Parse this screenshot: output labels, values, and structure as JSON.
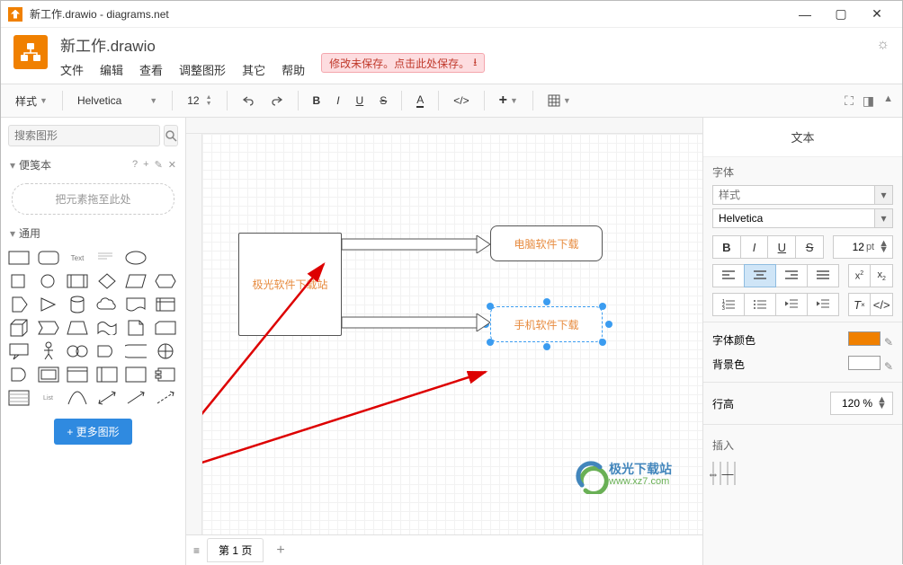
{
  "titlebar": {
    "title": "新工作.drawio - diagrams.net"
  },
  "header": {
    "filename": "新工作.drawio",
    "menus": [
      "文件",
      "编辑",
      "查看",
      "调整图形",
      "其它",
      "帮助"
    ],
    "save_warning": "修改未保存。点击此处保存。"
  },
  "toolbar": {
    "style_label": "样式",
    "font": "Helvetica",
    "font_size": "12"
  },
  "left": {
    "search_placeholder": "搜索图形",
    "scratchpad": "便笺本",
    "drop_hint": "把元素拖至此处",
    "general": "通用",
    "more_shapes": "+ 更多图形"
  },
  "canvas": {
    "box_main": "极光软件下载站",
    "box_top": "电脑软件下载",
    "box_bottom": "手机软件下载"
  },
  "pages": {
    "page1": "第 1 页"
  },
  "right": {
    "title": "文本",
    "font_lab": "字体",
    "style_ph": "样式",
    "font_name": "Helvetica",
    "size_val": "12",
    "size_unit": "pt",
    "font_color": "字体颜色",
    "bg_color": "背景色",
    "line_height": "行高",
    "line_height_val": "120 %",
    "insert": "插入"
  },
  "watermark": {
    "t1": "极光下载站",
    "t2": "www.xz7.com"
  }
}
